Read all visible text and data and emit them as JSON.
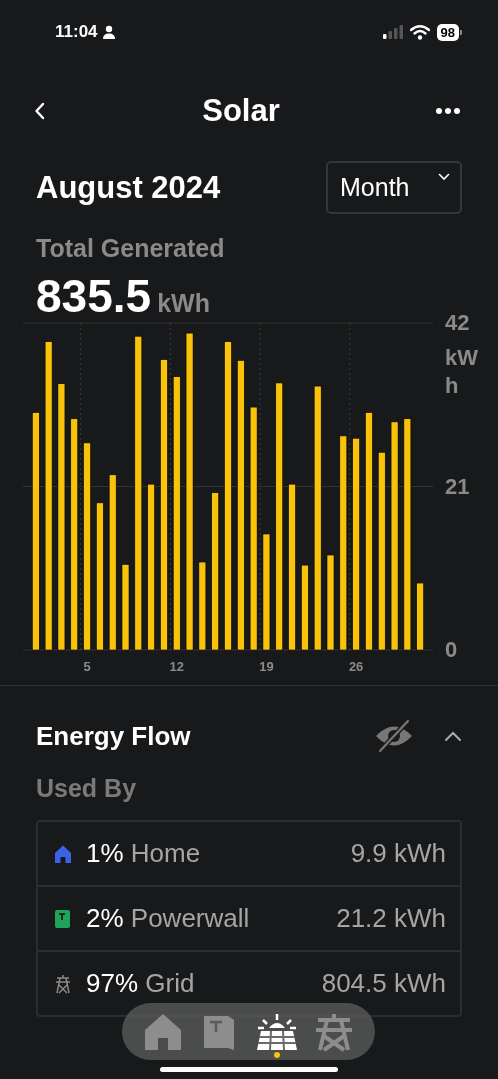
{
  "status_bar": {
    "time": "11:04",
    "battery": "98"
  },
  "nav": {
    "title": "Solar"
  },
  "header": {
    "period": "August 2024",
    "range": {
      "label": "Month"
    }
  },
  "total": {
    "label": "Total Generated",
    "value": "835.5",
    "unit": "kWh"
  },
  "chart_data": {
    "type": "bar",
    "x": [
      1,
      2,
      3,
      4,
      5,
      6,
      7,
      8,
      9,
      10,
      11,
      12,
      13,
      14,
      15,
      16,
      17,
      18,
      19,
      20,
      21,
      22,
      23,
      24,
      25,
      26,
      27,
      28,
      29,
      30,
      31
    ],
    "series": [
      {
        "color": "#f9c30b",
        "values": [
          30.5,
          39.6,
          34.2,
          29.7,
          26.6,
          18.9,
          22.5,
          11.0,
          40.3,
          21.3,
          37.3,
          35.1,
          40.7,
          11.3,
          20.2,
          39.6,
          37.2,
          31.2,
          14.9,
          34.3,
          21.3,
          10.9,
          33.9,
          12.2,
          27.5,
          27.2,
          30.5,
          25.4,
          29.3,
          29.7,
          8.6
        ]
      }
    ],
    "ylabel": "kWh",
    "ylim": [
      0,
      42
    ],
    "yticks": [
      0,
      21,
      42
    ],
    "xlim": [
      0,
      32
    ],
    "xticks": [
      5,
      12,
      19,
      26
    ]
  },
  "energy_flow": {
    "title": "Energy Flow",
    "expanded": true,
    "subtitle": "Used By",
    "rows": [
      {
        "kind": "home",
        "color": "#3b63e6",
        "percent": "1%",
        "name": "Home",
        "value": "9.9 kWh"
      },
      {
        "kind": "powerwall",
        "color": "#1fa35a",
        "percent": "2%",
        "name": "Powerwall",
        "value": "21.2 kWh"
      },
      {
        "kind": "grid",
        "color": "#8a8a8a",
        "percent": "97%",
        "name": "Grid",
        "value": "804.5 kWh"
      }
    ]
  },
  "tab_bar": {
    "items": [
      {
        "kind": "home",
        "selected": false
      },
      {
        "kind": "powerwall",
        "selected": false
      },
      {
        "kind": "solar",
        "selected": true
      },
      {
        "kind": "grid",
        "selected": false
      }
    ]
  }
}
